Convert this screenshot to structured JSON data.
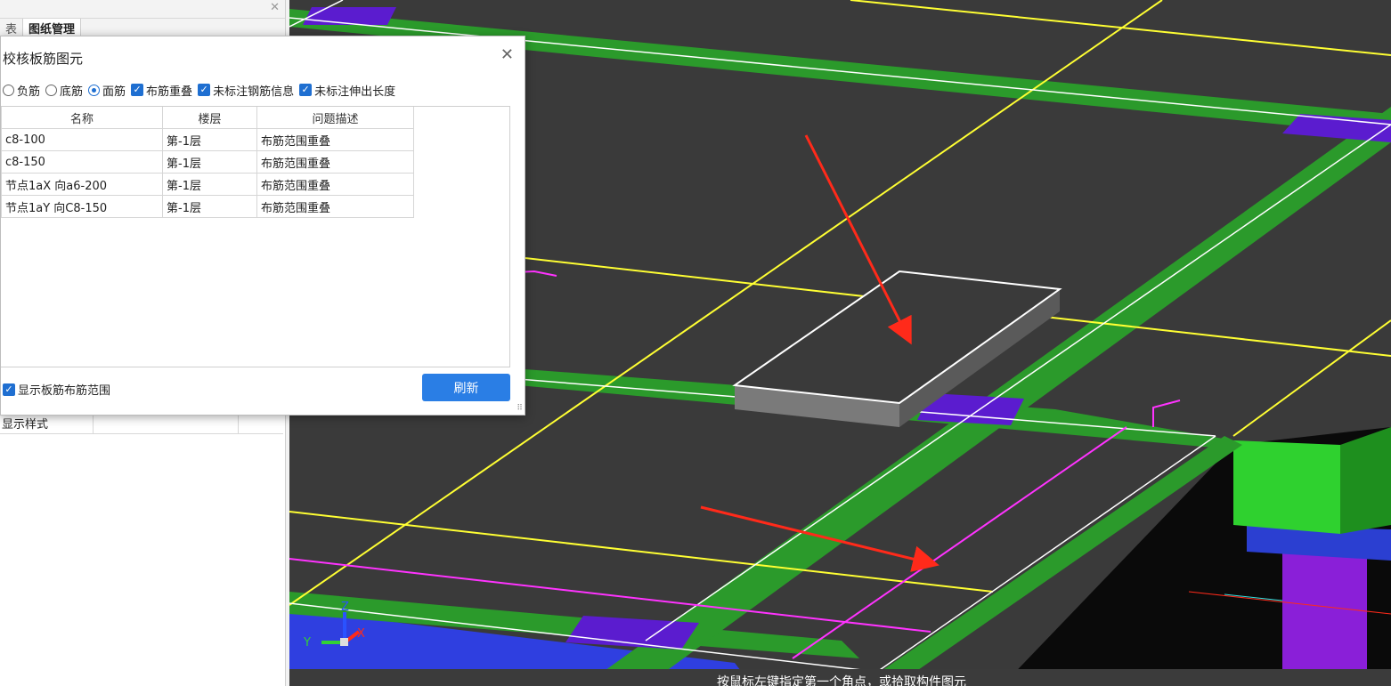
{
  "left_panel": {
    "tabs": [
      "表",
      "图纸管理"
    ],
    "active_tab": 1,
    "property_row_label": "显示样式"
  },
  "dialog": {
    "title": "校核板筋图元",
    "options": [
      {
        "type": "radio",
        "label": "负筋",
        "checked": false
      },
      {
        "type": "radio",
        "label": "底筋",
        "checked": false
      },
      {
        "type": "radio",
        "label": "面筋",
        "checked": true
      },
      {
        "type": "checkbox",
        "label": "布筋重叠",
        "checked": true
      },
      {
        "type": "checkbox",
        "label": "未标注钢筋信息",
        "checked": true
      },
      {
        "type": "checkbox",
        "label": "未标注伸出长度",
        "checked": true
      }
    ],
    "table": {
      "headers": [
        "名称",
        "楼层",
        "问题描述"
      ],
      "rows": [
        [
          "c8-100",
          "第-1层",
          "布筋范围重叠"
        ],
        [
          "c8-150",
          "第-1层",
          "布筋范围重叠"
        ],
        [
          "节点1aX 向a6-200",
          "第-1层",
          "布筋范围重叠"
        ],
        [
          "节点1aY 向C8-150",
          "第-1层",
          "布筋范围重叠"
        ]
      ]
    },
    "show_range_label": "显示板筋布筋范围",
    "show_range_checked": true,
    "refresh_label": "刷新"
  },
  "viewport": {
    "axis_labels": {
      "z": "Z",
      "y": "Y",
      "x": "X"
    },
    "status_text": "按鼠标左键指定第一个角点，或拾取构件图元"
  },
  "colors": {
    "accent": "#2a7ee5",
    "slab": "#3a3a3a",
    "beam": "#2b9a2b",
    "grid": "#ffff33",
    "rebar": "#ff33ff",
    "arrow": "#ff2a1a"
  }
}
